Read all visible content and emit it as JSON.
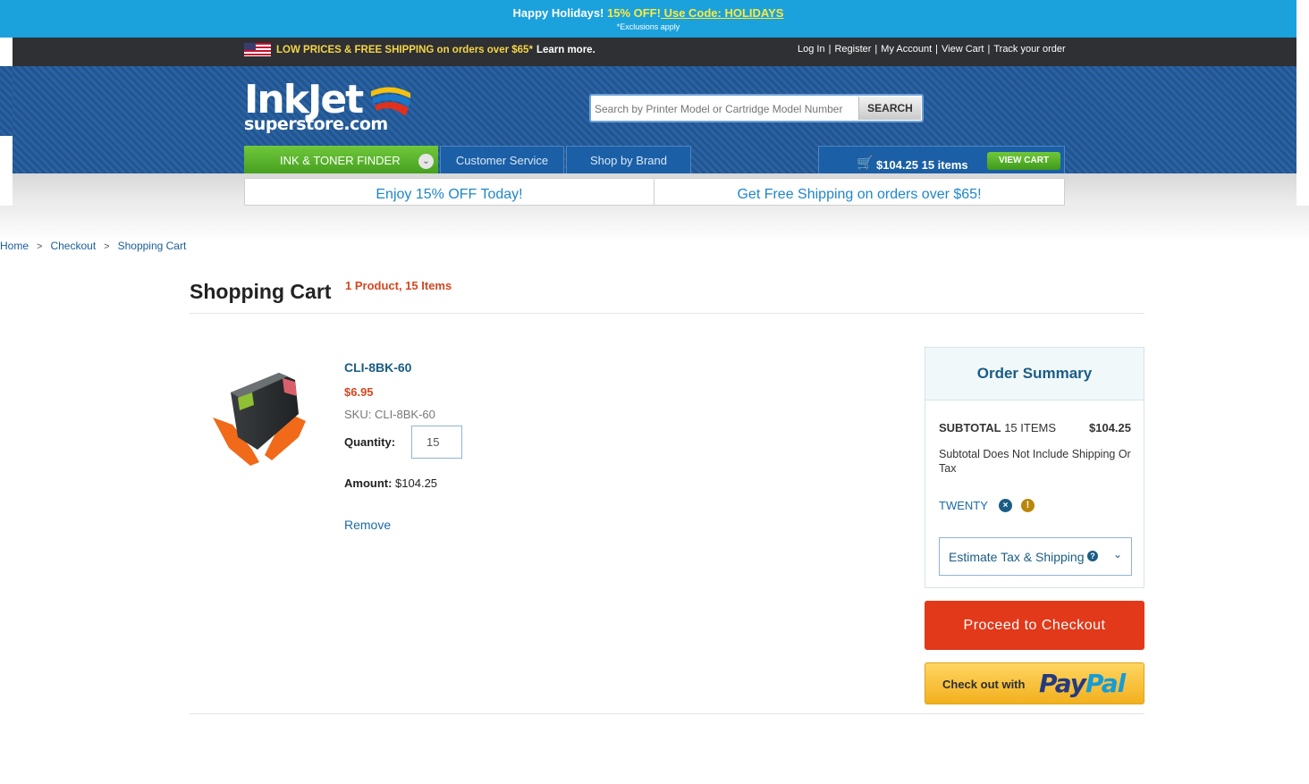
{
  "promo": {
    "lead": "Happy Holidays!",
    "offer": " 15% OFF!",
    "code": " Use Code: HOLIDAYS",
    "fine_print": "*Exclusions apply"
  },
  "topbar": {
    "shipping_text": "LOW PRICES & FREE SHIPPING on orders over $65*",
    "learn_more": "Learn more.",
    "links": [
      "Log In",
      "Register",
      "My Account",
      "View Cart",
      "Track your order"
    ]
  },
  "header": {
    "logo_main": "InkJet",
    "logo_sub": "superstore.com",
    "search_placeholder": "Search by Printer Model or Cartridge Model Number",
    "search_button": "SEARCH"
  },
  "nav": {
    "finder": "INK & TONER FINDER",
    "customer_service": "Customer Service",
    "shop_by_brand": "Shop by Brand",
    "cart_total": "$104.25  15 items",
    "view_cart": "VIEW CART"
  },
  "offers": [
    "Enjoy 15% OFF Today!",
    "Get Free Shipping on orders over $65!"
  ],
  "breadcrumb": [
    "Home",
    "Checkout",
    "Shopping Cart"
  ],
  "page": {
    "title": "Shopping Cart",
    "count": "1 Product, 15 Items"
  },
  "product": {
    "name": "CLI-8BK-60",
    "price": "$6.95",
    "sku": "SKU: CLI-8BK-60",
    "quantity_label": "Quantity:",
    "quantity": "15",
    "amount_label": "Amount:",
    "amount": " $104.25",
    "remove": "Remove"
  },
  "summary": {
    "title": "Order Summary",
    "subtotal_label": "SUBTOTAL",
    "subtotal_items": " 15 ITEMS",
    "subtotal_value": "$104.25",
    "note": "Subtotal Does Not Include Shipping Or Tax",
    "coupon": "TWENTY",
    "estimate": "Estimate Tax & Shipping",
    "checkout": "Proceed to Checkout",
    "paypal_prefix": "Check out with",
    "paypal_pay": "Pay",
    "paypal_pal": "Pal"
  },
  "colors": {
    "promo_bg": "#1ba1dc",
    "header_blue": "#2a63a3",
    "accent_green": "#4fa82a",
    "price_red": "#d54620",
    "checkout_red": "#e1391a",
    "paypal_yellow": "#f6c03a"
  }
}
